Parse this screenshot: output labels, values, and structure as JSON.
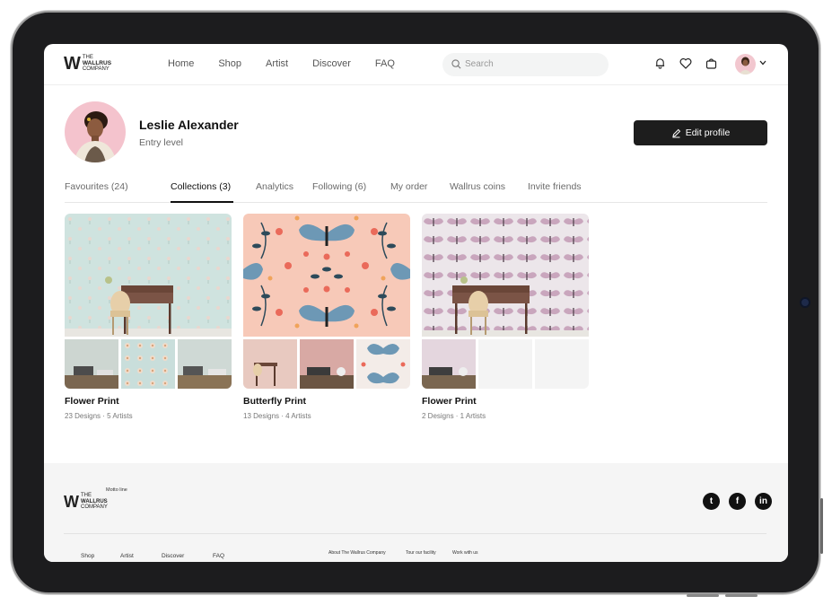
{
  "brand": {
    "line1": "THE",
    "line2": "WALLRUS",
    "line3": "COMPANY",
    "mark": "W"
  },
  "nav": [
    "Home",
    "Shop",
    "Artist",
    "Discover",
    "FAQ"
  ],
  "search": {
    "placeholder": "Search",
    "icon": "search-icon"
  },
  "header_icons": [
    "bell-icon",
    "heart-icon",
    "bag-icon"
  ],
  "profile": {
    "name": "Leslie Alexander",
    "level": "Entry level",
    "edit_label": "Edit profile"
  },
  "tabs": [
    "Favourites (24)",
    "Collections (3)",
    "Analytics",
    "Following (6)",
    "My order",
    "Wallrus coins",
    "Invite friends"
  ],
  "active_tab": "Collections (3)",
  "collections": [
    {
      "title": "Flower Print",
      "meta": "23 Designs · 5 Artists"
    },
    {
      "title": "Butterfly Print",
      "meta": "13 Designs · 4 Artists"
    },
    {
      "title": "Flower Print",
      "meta": "2 Designs · 1 Artists"
    }
  ],
  "footer": {
    "motto": "Motto line",
    "links": [
      "Shop",
      "Artist",
      "Discover",
      "FAQ"
    ],
    "links2": [
      "About The Wallrus Company",
      "Tour our facility",
      "Work with us"
    ],
    "social": [
      "twitter-icon",
      "facebook-icon",
      "linkedin-icon"
    ],
    "social_glyphs": [
      "t",
      "f",
      "in"
    ]
  },
  "colors": {
    "accent_dark": "#1d1d1d",
    "avatar_bg": "#f4c3cd",
    "butterfly_bg": "#f7c9b8",
    "footer_bg": "#f5f5f5"
  }
}
